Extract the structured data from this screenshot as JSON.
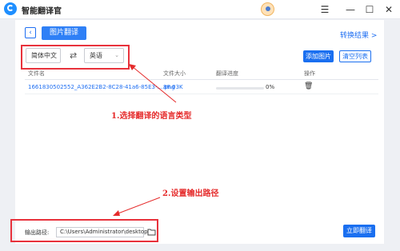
{
  "app": {
    "title": "智能翻译官"
  },
  "header": {
    "tab_label": "图片翻译",
    "convert_result": "转换结果 >"
  },
  "languages": {
    "source": "简体中文",
    "target": "英语"
  },
  "buttons": {
    "add_image": "添加图片",
    "clear_list": "清空列表",
    "translate_now": "立即翻译"
  },
  "table": {
    "headers": [
      "文件名",
      "文件大小",
      "翻译进度",
      "操作"
    ],
    "rows": [
      {
        "filename": "1661830502552_A362E2B2-8C28-41a6-85E3-....png",
        "size": "88.03K",
        "progress_text": "0%",
        "progress": 0
      }
    ]
  },
  "annotations": {
    "step1": "1.选择翻译的语言类型",
    "step2": "2.设置输出路径"
  },
  "output": {
    "label": "输出路径:",
    "path": "C:\\Users\\Administrator\\desktop"
  },
  "colors": {
    "accent": "#1a6ff0",
    "highlight": "#e8323c"
  }
}
